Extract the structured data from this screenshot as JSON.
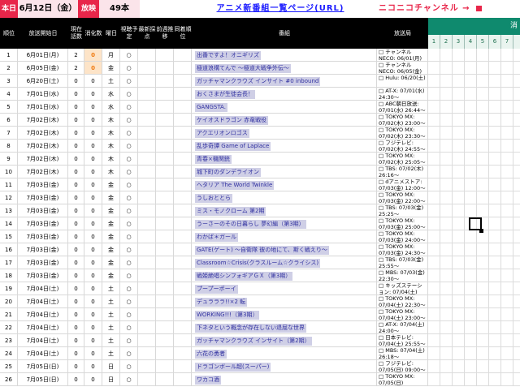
{
  "toolbar": {
    "today_label": "本日",
    "date_value": "6月12日（金）",
    "broadcast_label": "放映",
    "count_value": "49本",
    "list_link": "アニメ新番組一覧ページ(URL)",
    "nico_link": "ニコニコチャンネル →"
  },
  "colors": {
    "accent_red": "#e8264a",
    "header_black": "#000000",
    "green": "#0f8a6e",
    "orange": "#f07a10"
  },
  "columns": {
    "order": "順位",
    "start_date": "放送開始日",
    "current_episodes": "現在話数",
    "consumed": "消化数",
    "weekday": "曜日",
    "watch_plan": "視聴予定",
    "latest_score": "最新採点",
    "prev_week": "前週推移",
    "same_rank": "同着順位",
    "program": "番組",
    "station": "放送局",
    "right_header": "消化",
    "day_numbers": [
      "1",
      "2",
      "3",
      "4",
      "5",
      "6",
      "7"
    ]
  },
  "rows": [
    {
      "order": "1",
      "date": "6月01日(月)",
      "ep": "2",
      "done": "0",
      "wd": "月",
      "plan": "○",
      "title": "出番ですよ！オニギリズ",
      "station": "□ チャンネルNECO: 06/01(月)"
    },
    {
      "order": "2",
      "date": "6月05日(金)",
      "ep": "2",
      "done": "0",
      "wd": "金",
      "plan": "○",
      "title": "極道浪構てんで ～極道大戦争外伝～",
      "station": "□ チャンネルNECO: 06/05(金)"
    },
    {
      "order": "3",
      "date": "6月20日(土)",
      "ep": "0",
      "done": "0",
      "wd": "土",
      "plan": "○",
      "title": "ガッチャマンクラウズ インサイト #0 inbound",
      "station": "□ Hulu: 06/20(土)"
    },
    {
      "order": "4",
      "date": "7月01日(水)",
      "ep": "0",
      "done": "0",
      "wd": "水",
      "plan": "○",
      "title": "おくさまが生徒会長！",
      "station": "□ AT-X: 07/01(水) 24:30～"
    },
    {
      "order": "5",
      "date": "7月01日(水)",
      "ep": "0",
      "done": "0",
      "wd": "水",
      "plan": "○",
      "title": "GANGSTA.",
      "station": "□ ABC朝日放送: 07/01(水) 26:44～"
    },
    {
      "order": "6",
      "date": "7月02日(木)",
      "ep": "0",
      "done": "0",
      "wd": "木",
      "plan": "○",
      "title": "ケイオスドラゴン 赤竜戦役",
      "station": "□ TOKYO MX: 07/02(木) 23:00～"
    },
    {
      "order": "7",
      "date": "7月02日(木)",
      "ep": "0",
      "done": "0",
      "wd": "木",
      "plan": "○",
      "title": "アクエリオンロゴス",
      "station": "□ TOKYO MX: 07/02(木) 23:30～"
    },
    {
      "order": "8",
      "date": "7月02日(木)",
      "ep": "0",
      "done": "0",
      "wd": "木",
      "plan": "○",
      "title": "乱歩奇譚 Game of Laplace",
      "station": "□ フジテレビ: 07/02(木) 24:55～"
    },
    {
      "order": "9",
      "date": "7月02日(木)",
      "ep": "0",
      "done": "0",
      "wd": "木",
      "plan": "○",
      "title": "青春×機関銃",
      "station": "□ TOKYO MX: 07/02(木) 25:05～"
    },
    {
      "order": "10",
      "date": "7月02日(木)",
      "ep": "0",
      "done": "0",
      "wd": "木",
      "plan": "○",
      "title": "城下町のダンデライオン",
      "station": "□ TBS: 07/02(木) 26:16～"
    },
    {
      "order": "11",
      "date": "7月03日(金)",
      "ep": "0",
      "done": "0",
      "wd": "金",
      "plan": "○",
      "title": "ヘタリア The World Twinkle",
      "station": "□ dアニメストア: 07/03(金) 12:00～"
    },
    {
      "order": "12",
      "date": "7月03日(金)",
      "ep": "0",
      "done": "0",
      "wd": "金",
      "plan": "○",
      "title": "うしおととら",
      "station": "□ TOKYO MX: 07/03(金) 22:00～"
    },
    {
      "order": "13",
      "date": "7月03日(金)",
      "ep": "0",
      "done": "0",
      "wd": "金",
      "plan": "○",
      "title": "ミス・モノクローム 第2期",
      "station": "□ TBS: 07/03(金) 25:25～"
    },
    {
      "order": "14",
      "date": "7月03日(金)",
      "ep": "0",
      "done": "0",
      "wd": "金",
      "plan": "○",
      "title": "うーさーのその日暮らし 夢幻編（第3期）",
      "station": "□ TOKYO MX: 07/03(金) 25:00～"
    },
    {
      "order": "15",
      "date": "7月03日(金)",
      "ep": "0",
      "done": "0",
      "wd": "金",
      "plan": "○",
      "title": "わかば＊ガール",
      "station": "□ TOKYO MX: 07/03(金) 24:00～"
    },
    {
      "order": "16",
      "date": "7月03日(金)",
      "ep": "0",
      "done": "0",
      "wd": "金",
      "plan": "○",
      "title": "GATE(ゲート) ～自衛隊 彼の地にて、斯く戦えり～",
      "station": "□ TOKYO MX: 07/03(金) 24:30～"
    },
    {
      "order": "17",
      "date": "7月03日(金)",
      "ep": "0",
      "done": "0",
      "wd": "金",
      "plan": "○",
      "title": "Classroom☆Crisis(クラスルーム☆クライシス)",
      "station": "□ TBS: 07/03(金) 25:55～"
    },
    {
      "order": "18",
      "date": "7月03日(金)",
      "ep": "0",
      "done": "0",
      "wd": "金",
      "plan": "○",
      "title": "戦姫絶唱シンフォギアＧＸ（第3期）",
      "station": "□ MBS: 07/03(金) 22:30～"
    },
    {
      "order": "19",
      "date": "7月04日(土)",
      "ep": "0",
      "done": "0",
      "wd": "土",
      "plan": "○",
      "title": "プープーポーイ",
      "station": "□ キッズステーション: 07/04(土)"
    },
    {
      "order": "20",
      "date": "7月04日(土)",
      "ep": "0",
      "done": "0",
      "wd": "土",
      "plan": "○",
      "title": "デュラララ!!×2 転",
      "station": "□ TOKYO MX: 07/04(土) 22:30～"
    },
    {
      "order": "21",
      "date": "7月04日(土)",
      "ep": "0",
      "done": "0",
      "wd": "土",
      "plan": "○",
      "title": "WORKING!!!（第3期）",
      "station": "□ TOKYO MX: 07/04(土) 23:00～"
    },
    {
      "order": "22",
      "date": "7月04日(土)",
      "ep": "0",
      "done": "0",
      "wd": "土",
      "plan": "○",
      "title": "下ネタという概念が存在しない退屈な世界",
      "station": "□ AT-X: 07/04(土) 24:00～"
    },
    {
      "order": "23",
      "date": "7月04日(土)",
      "ep": "0",
      "done": "0",
      "wd": "土",
      "plan": "○",
      "title": "ガッチャマンクラウズ インサイト（第2期）",
      "station": "□ 日本テレビ: 07/04(土) 25:55～"
    },
    {
      "order": "24",
      "date": "7月04日(土)",
      "ep": "0",
      "done": "0",
      "wd": "土",
      "plan": "○",
      "title": "六花の勇者",
      "station": "□ MBS: 07/04(土) 26:18～"
    },
    {
      "order": "25",
      "date": "7月05日(日)",
      "ep": "0",
      "done": "0",
      "wd": "日",
      "plan": "○",
      "title": "ドラゴンボール超(スーパー)",
      "station": "□ フジテレビ: 07/05(日) 09:00～"
    },
    {
      "order": "26",
      "date": "7月05日(日)",
      "ep": "0",
      "done": "0",
      "wd": "日",
      "plan": "○",
      "title": "ワカコ酒",
      "station": "□ TOKYO MX: 07/05(日)"
    }
  ]
}
